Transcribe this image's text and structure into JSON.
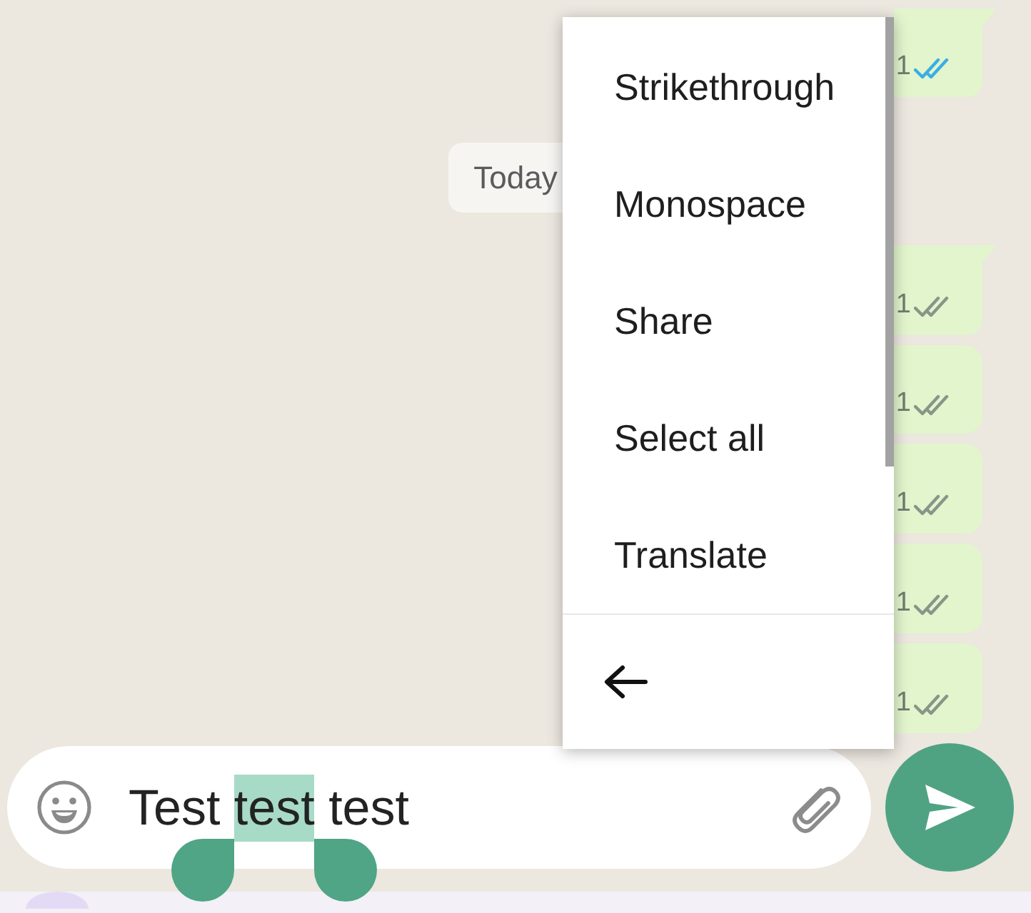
{
  "chat": {
    "items": [
      {
        "kind": "message",
        "time": "1",
        "read": true,
        "tail": true
      },
      {
        "kind": "date",
        "label": "Today"
      },
      {
        "kind": "message",
        "time": "1",
        "read": false,
        "tail": true
      },
      {
        "kind": "message",
        "time": "1",
        "read": false,
        "tail": false
      },
      {
        "kind": "message",
        "time": "1",
        "read": false,
        "tail": false
      },
      {
        "kind": "message",
        "time": "1",
        "read": false,
        "tail": false
      },
      {
        "kind": "message",
        "time": "1",
        "read": false,
        "tail": false
      }
    ]
  },
  "context_menu": {
    "items": [
      "Strikethrough",
      "Monospace",
      "Share",
      "Select all",
      "Translate"
    ]
  },
  "composer": {
    "segments": [
      {
        "text": "Test ",
        "selected": false
      },
      {
        "text": "test",
        "selected": true
      },
      {
        "text": " test",
        "selected": false
      }
    ]
  }
}
